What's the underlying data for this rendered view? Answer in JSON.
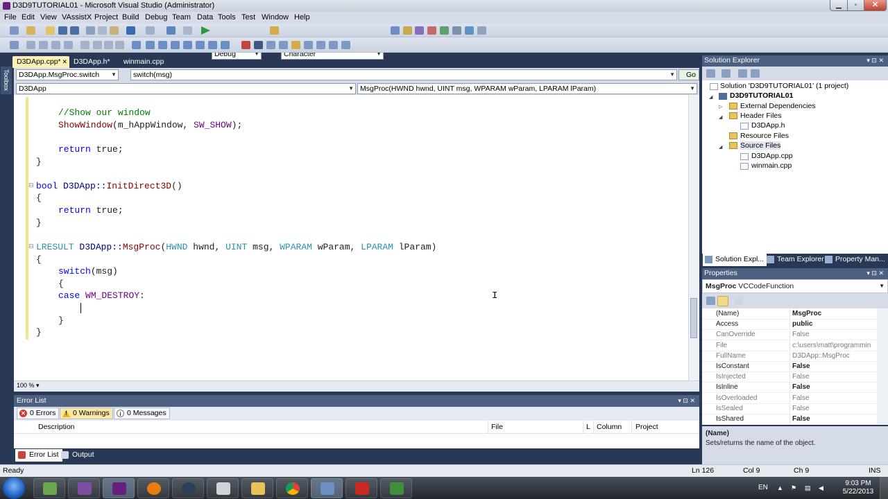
{
  "window": {
    "title": "D3D9TUTORIAL01 - Microsoft Visual Studio (Administrator)"
  },
  "menu": [
    "File",
    "Edit",
    "View",
    "VAssistX",
    "Project",
    "Build",
    "Debug",
    "Team",
    "Data",
    "Tools",
    "Test",
    "Window",
    "Help"
  ],
  "toolbar": {
    "config": "Debug",
    "find": "Character"
  },
  "toolbox_label": "Toolbox",
  "doc_tabs": [
    "D3DApp.cpp*",
    "D3DApp.h*",
    "winmain.cpp"
  ],
  "nav": {
    "scope": "D3DApp.MsgProc.switch",
    "symbol": "switch(msg)",
    "go": "Go",
    "class": "D3DApp",
    "member": "MsgProc(HWND hwnd, UINT msg, WPARAM wParam, LPARAM lParam)"
  },
  "code": {
    "l1": "//Show our window",
    "l2a": "ShowWindow",
    "l2b": "(m_hAppWindow, ",
    "l2c": "SW_SHOW",
    "l2d": ");",
    "l4a": "return",
    "l4b": " true;",
    "l5": "}",
    "l7a": "bool",
    "l7b": " D3DApp::",
    "l7c": "InitDirect3D",
    "l7d": "()",
    "l8": "{",
    "l9a": "return",
    "l9b": " true;",
    "l10": "}",
    "l12a": "LRESULT",
    "l12b": " D3DApp::",
    "l12c": "MsgProc",
    "l12d": "(",
    "l12e": "HWND",
    "l12f": " hwnd, ",
    "l12g": "UINT",
    "l12h": " msg, ",
    "l12i": "WPARAM",
    "l12j": " wParam, ",
    "l12k": "LPARAM",
    "l12l": " lParam)",
    "l13": "{",
    "l14a": "switch",
    "l14b": "(msg)",
    "l15": "{",
    "l16a": "case",
    "l16b": " ",
    "l16c": "WM_DESTROY",
    "l16d": ":",
    "l18": "}",
    "l19": "}"
  },
  "editor": {
    "zoom": "100 %"
  },
  "error_list": {
    "title": "Error List",
    "errors": "0 Errors",
    "warnings": "0 Warnings",
    "messages": "0 Messages",
    "columns": [
      "Description",
      "File",
      "L",
      "Column",
      "Project"
    ],
    "tabs": [
      "Error List",
      "Output"
    ]
  },
  "solution_explorer": {
    "title": "Solution Explorer",
    "items": [
      "Solution 'D3D9TUTORIAL01' (1 project)",
      "D3D9TUTORIAL01",
      "External Dependencies",
      "Header Files",
      "D3DApp.h",
      "Resource Files",
      "Source Files",
      "D3DApp.cpp",
      "winmain.cpp"
    ],
    "tabs": [
      "Solution Expl...",
      "Team Explorer",
      "Property Man..."
    ]
  },
  "properties": {
    "title": "Properties",
    "object": "MsgProc",
    "object_type": "VCCodeFunction",
    "rows": [
      {
        "name": "(Name)",
        "value": "MsgProc"
      },
      {
        "name": "Access",
        "value": "public"
      },
      {
        "name": "CanOverride",
        "value": "False"
      },
      {
        "name": "File",
        "value": "c:\\users\\matt\\programmin"
      },
      {
        "name": "FullName",
        "value": "D3DApp::MsgProc"
      },
      {
        "name": "IsConstant",
        "value": "False"
      },
      {
        "name": "IsInjected",
        "value": "False"
      },
      {
        "name": "IsInline",
        "value": "False"
      },
      {
        "name": "IsOverloaded",
        "value": "False"
      },
      {
        "name": "IsSealed",
        "value": "False"
      },
      {
        "name": "IsShared",
        "value": "False"
      }
    ],
    "desc_name": "(Name)",
    "desc_text": "Sets/returns the name of the object."
  },
  "status": {
    "text": "Ready",
    "ln": "Ln 126",
    "col": "Col 9",
    "ch": "Ch 9",
    "mode": "INS"
  },
  "tray": {
    "lang": "EN",
    "time": "9:03 PM",
    "date": "5/22/2013"
  }
}
